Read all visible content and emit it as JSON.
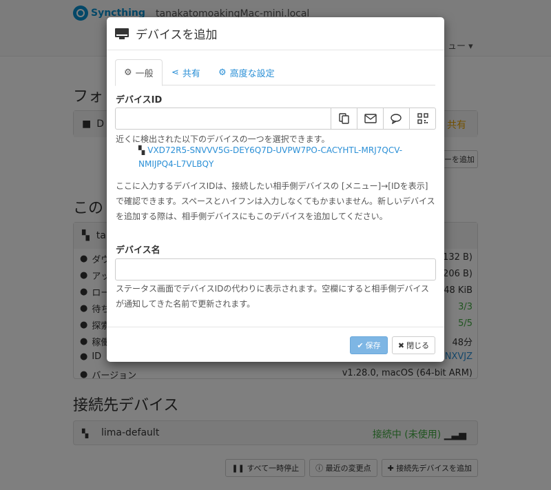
{
  "app": {
    "logo_text": "Syncthing",
    "hostname": "tanakatomoakingMac-mini.local",
    "actions_menu": "ュー ▾"
  },
  "background": {
    "folders_title": "フォ",
    "folder_row_label": "D",
    "folder_share": "共有",
    "add_folder_button": "ーを追加",
    "this_device_title": "この",
    "this_device_name": "ta",
    "stats": [
      {
        "label": "ダウ",
        "value": "(132 B)"
      },
      {
        "label": "アッ",
        "value": "(206 B)"
      },
      {
        "label": "ロー",
        "value": ".48 KiB"
      },
      {
        "label": "待ち",
        "value": "3/3"
      },
      {
        "label": "探索",
        "value": "5/5"
      },
      {
        "label": "稼働",
        "value": "48分"
      },
      {
        "label": "ID",
        "value": "NXVJZ"
      },
      {
        "label": "バージョン",
        "value": "v1.28.0, macOS (64-bit ARM)"
      }
    ],
    "remote_devices_title": "接続先デバイス",
    "remote_device": {
      "name": "lima-default",
      "status": "接続中 (未使用)"
    },
    "bottom_buttons": {
      "pause_all": "すべて一時停止",
      "recent_changes": "最近の変更点",
      "add_device": "接続先デバイスを追加"
    }
  },
  "modal": {
    "title": "デバイスを追加",
    "tabs": [
      {
        "label": "一般",
        "icon": "gear-icon"
      },
      {
        "label": "共有",
        "icon": "share-icon"
      },
      {
        "label": "高度な設定",
        "icon": "cogs-icon"
      }
    ],
    "device_id_label": "デバイスID",
    "device_id_value": "",
    "nearby_help": "近くに検出された以下のデバイスの一つを選択できます。",
    "nearby_device_id": "VXD72R5-SNVVV5G-DEY6Q7D-UVPW7PO-CACYHTL-MRJ7QCV-NMIJPQ4-L7VLBQY",
    "id_help": "ここに入力するデバイスIDは、接続したい相手側デバイスの [メニュー]→[IDを表示] で確認できます。スペースとハイフンは入力しなくてもかまいません。新しいデバイスを追加する際は、相手側デバイスにもこのデバイスを追加してください。",
    "device_name_label": "デバイス名",
    "device_name_value": "",
    "name_help": "ステータス画面でデバイスIDの代わりに表示されます。空欄にすると相手側デバイスが通知してきた名前で更新されます。",
    "save_button": "保存",
    "close_button": "閉じる"
  }
}
